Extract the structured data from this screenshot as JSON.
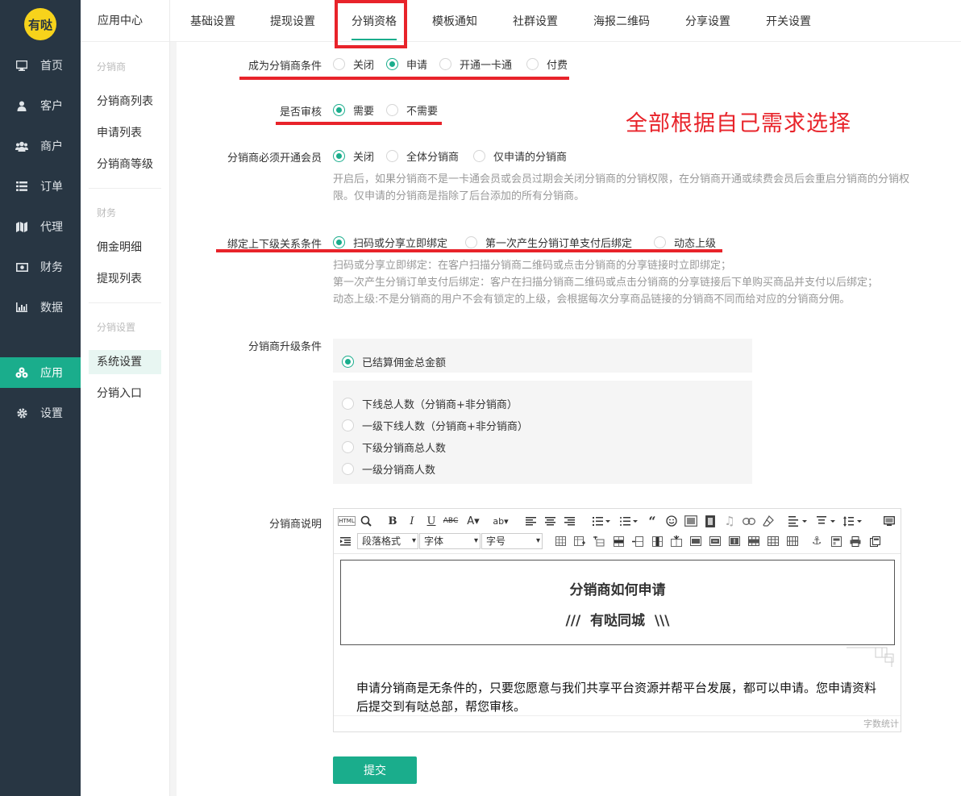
{
  "app": {
    "logo_text": "有哒"
  },
  "nav": {
    "items": [
      {
        "label": "首页",
        "icon": "monitor-icon"
      },
      {
        "label": "客户",
        "icon": "user-icon"
      },
      {
        "label": "商户",
        "icon": "users-icon"
      },
      {
        "label": "订单",
        "icon": "list-icon"
      },
      {
        "label": "代理",
        "icon": "map-icon"
      },
      {
        "label": "财务",
        "icon": "money-icon"
      },
      {
        "label": "数据",
        "icon": "bar-chart-icon"
      },
      {
        "label": "应用",
        "icon": "cubes-icon"
      },
      {
        "label": "设置",
        "icon": "gear-icon"
      }
    ],
    "active": "应用",
    "accent": "#1aad8c"
  },
  "submenu": {
    "title": "应用中心",
    "groups": [
      {
        "title": "分销商",
        "items": [
          "分销商列表",
          "申请列表",
          "分销商等级"
        ]
      },
      {
        "title": "财务",
        "items": [
          "佣金明细",
          "提现列表"
        ]
      },
      {
        "title": "分销设置",
        "items": [
          "系统设置",
          "分销入口"
        ]
      }
    ],
    "active": "系统设置"
  },
  "tabs": {
    "items": [
      "基础设置",
      "提现设置",
      "分销资格",
      "模板通知",
      "社群设置",
      "海报二维码",
      "分享设置",
      "开关设置"
    ],
    "active": "分销资格"
  },
  "annotation": {
    "text": "全部根据自己需求选择",
    "color": "#e8232a"
  },
  "form": {
    "become_condition": {
      "label": "成为分销商条件",
      "options": [
        "关闭",
        "申请",
        "开通一卡通",
        "付费"
      ],
      "selected": "申请"
    },
    "audit": {
      "label": "是否审核",
      "options": [
        "需要",
        "不需要"
      ],
      "selected": "需要"
    },
    "member_required": {
      "label": "分销商必须开通会员",
      "options": [
        "关闭",
        "全体分销商",
        "仅申请的分销商"
      ],
      "selected": "关闭",
      "hint": [
        "开启后，如果分销商不是一卡通会员或会员过期会关闭分销商的分销权限，在分销商开通或续费会员后会重启分销商的分销权",
        "限。仅申请的分销商是指除了后台添加的所有分销商。"
      ]
    },
    "bind_condition": {
      "label": "绑定上下级关系条件",
      "options": [
        "扫码或分享立即绑定",
        "第一次产生分销订单支付后绑定",
        "动态上级"
      ],
      "selected": "扫码或分享立即绑定",
      "hint": [
        "扫码或分享立即绑定：在客户扫描分销商二维码或点击分销商的分享链接时立即绑定；",
        "第一次产生分销订单支付后绑定：客户在扫描分销商二维码或点击分销商的分享链接后下单购买商品并支付以后绑定；",
        "动态上级:不是分销商的用户不会有锁定的上级，会根据每次分享商品链接的分销商不同而给对应的分销商分佣。"
      ]
    },
    "upgrade_condition": {
      "label": "分销商升级条件",
      "primary": "已结算佣金总金额",
      "primary_selected": true,
      "others": [
        "下线总人数（分销商+非分销商）",
        "一级下线人数（分销商+非分销商）",
        "下级分销商总人数",
        "一级分销商人数"
      ]
    },
    "description": {
      "label": "分销商说明",
      "toolbar_html": "HTML",
      "paragraph_select": "段落格式",
      "font_select": "字体",
      "size_select": "字号",
      "content_title": "分销商如何申请",
      "content_subtitle": "///  有哒同城  \\\\\\",
      "content_text": "申请分销商是无条件的，只要您愿意与我们共享平台资源并帮平台发展，都可以申请。您申请资料后提交到有哒总部，帮您审核。",
      "word_count": "字数统计"
    },
    "submit_label": "提交"
  }
}
